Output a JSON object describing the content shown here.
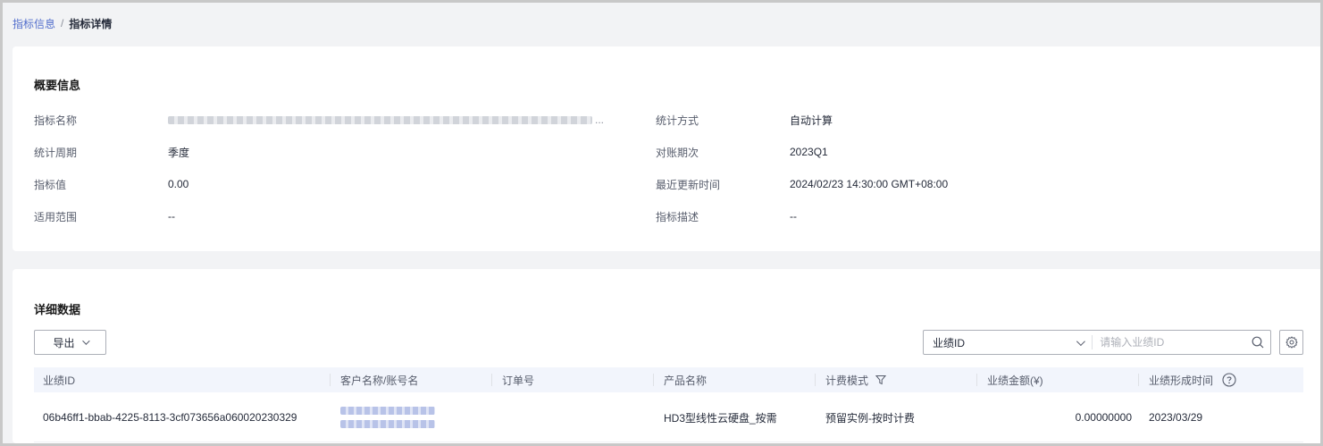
{
  "breadcrumb": {
    "parent": "指标信息",
    "separator": "/",
    "current": "指标详情"
  },
  "summary": {
    "title": "概要信息",
    "rows": [
      {
        "label": "指标名称",
        "value": "",
        "blurred": true
      },
      {
        "label": "统计周期",
        "value": "季度"
      },
      {
        "label": "指标值",
        "value": "0.00"
      },
      {
        "label": "适用范围",
        "value": "--"
      }
    ],
    "rows_right": [
      {
        "label": "统计方式",
        "value": "自动计算"
      },
      {
        "label": "对账期次",
        "value": "2023Q1"
      },
      {
        "label": "最近更新时间",
        "value": "2024/02/23 14:30:00 GMT+08:00"
      },
      {
        "label": "指标描述",
        "value": "--"
      }
    ],
    "name_ellipsis": "..."
  },
  "detail": {
    "title": "详细数据",
    "export_label": "导出",
    "search": {
      "field": "业绩ID",
      "placeholder": "请输入业绩ID"
    },
    "columns": {
      "id": "业绩ID",
      "customer": "客户名称/账号名",
      "order": "订单号",
      "product": "产品名称",
      "billing": "计费模式",
      "amount": "业绩金额(¥)",
      "time": "业绩形成时间"
    },
    "rows": [
      {
        "id": "06b46ff1-bbab-4225-8113-3cf073656a060020230329",
        "order": "",
        "product": "HD3型线性云硬盘_按需",
        "billing": "预留实例-按时计费",
        "amount": "0.00000000",
        "time": "2023/03/29"
      }
    ]
  },
  "icons": {
    "chevron": "chevron-down-icon",
    "search": "search-icon",
    "settings": "gear-icon",
    "filter": "filter-icon",
    "help": "question-circle-icon"
  },
  "colors": {
    "link": "#526ecc",
    "header_bg": "#f2f5fc",
    "page_bg": "#f2f3f5"
  }
}
